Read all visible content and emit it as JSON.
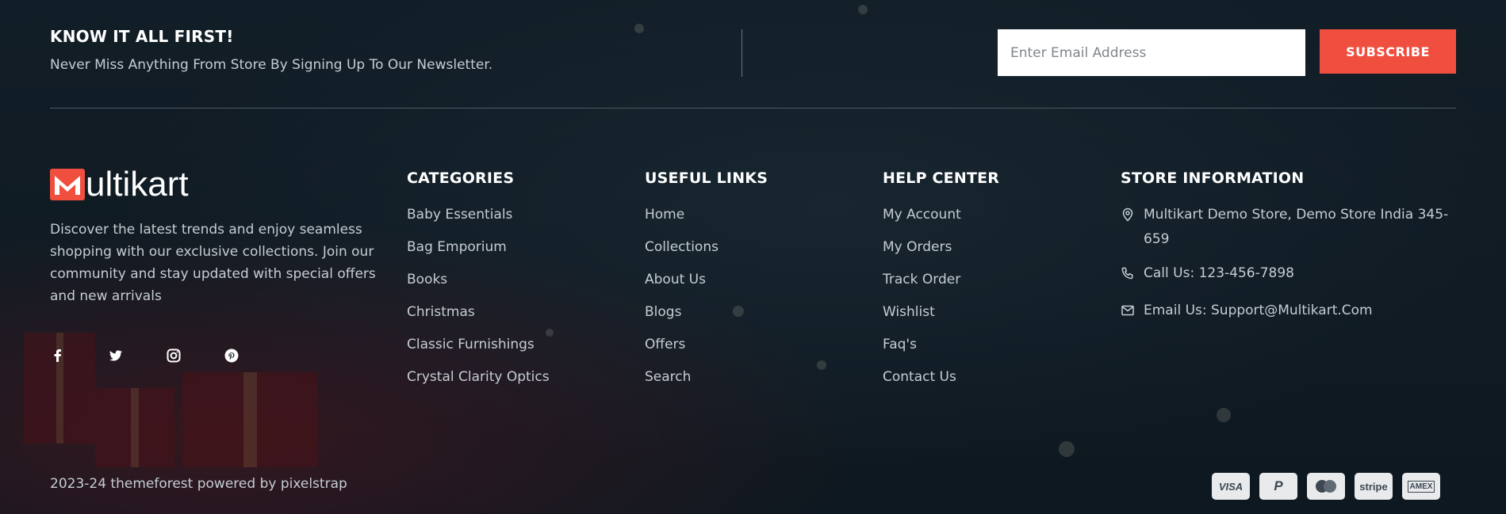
{
  "newsletter": {
    "title": "KNOW IT ALL FIRST!",
    "subtitle": "Never Miss Anything From Store By Signing Up To Our Newsletter.",
    "email_placeholder": "Enter Email Address",
    "subscribe_label": "SUBSCRIBE"
  },
  "brand": {
    "logo_text": "ultikart",
    "logo_letter": "M",
    "description": "Discover the latest trends and enjoy seamless shopping with our exclusive collections. Join our community and stay updated with special offers and new arrivals"
  },
  "socials": [
    {
      "name": "facebook-icon"
    },
    {
      "name": "twitter-icon"
    },
    {
      "name": "instagram-icon"
    },
    {
      "name": "pinterest-icon"
    }
  ],
  "categories": {
    "title": "CATEGORIES",
    "items": [
      "Baby Essentials",
      "Bag Emporium",
      "Books",
      "Christmas",
      "Classic Furnishings",
      "Crystal Clarity Optics"
    ]
  },
  "useful_links": {
    "title": "USEFUL LINKS",
    "items": [
      "Home",
      "Collections",
      "About Us",
      "Blogs",
      "Offers",
      "Search"
    ]
  },
  "help_center": {
    "title": "HELP CENTER",
    "items": [
      "My Account",
      "My Orders",
      "Track Order",
      "Wishlist",
      "Faq's",
      "Contact Us"
    ]
  },
  "store_info": {
    "title": "STORE INFORMATION",
    "address": "Multikart Demo Store, Demo Store India 345-659",
    "call": "Call Us: 123-456-7898",
    "email": "Email Us: Support@Multikart.Com"
  },
  "footer": {
    "copyright": "2023-24 themeforest powered by pixelstrap",
    "payments": [
      "VISA",
      "P",
      "",
      "stripe",
      "AMEX"
    ]
  },
  "colors": {
    "accent": "#f04e3e",
    "background": "#0f1a22",
    "heading": "#ffffff",
    "text": "#c5cdd3"
  }
}
